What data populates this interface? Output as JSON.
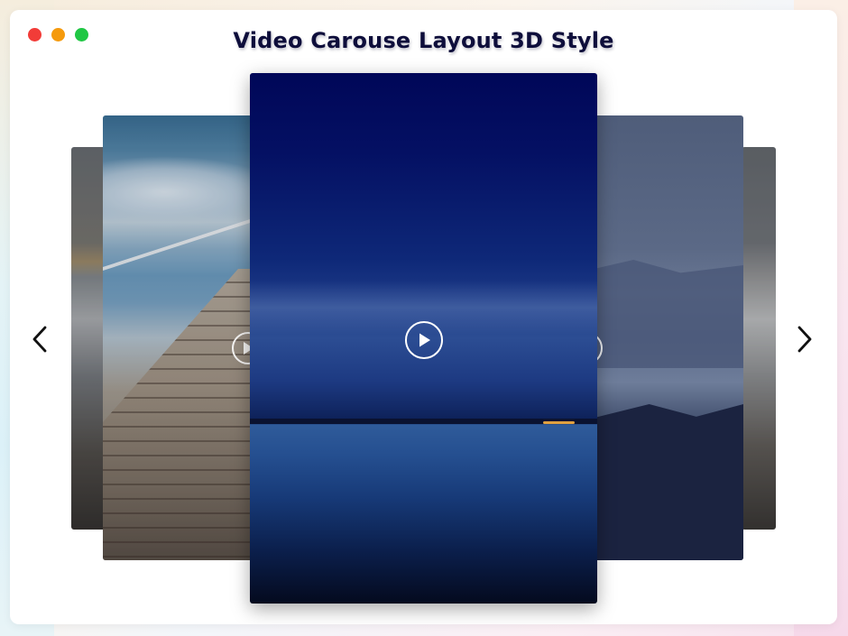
{
  "window": {
    "title": "Video Carouse Layout 3D Style",
    "controls": [
      "close",
      "minimize",
      "maximize"
    ]
  },
  "carousel": {
    "slides": [
      {
        "position": "far-left",
        "scene": "sea-of-clouds",
        "icon": "play-icon"
      },
      {
        "position": "left",
        "scene": "wooden-pier",
        "icon": "play-icon"
      },
      {
        "position": "center",
        "scene": "blue-lake-horizon",
        "icon": "play-icon",
        "active": true
      },
      {
        "position": "right",
        "scene": "misty-mountains",
        "icon": "play-icon"
      },
      {
        "position": "far-right",
        "scene": "sea-of-clouds",
        "icon": "play-icon"
      }
    ],
    "prev_icon": "chevron-left-icon",
    "next_icon": "chevron-right-icon"
  },
  "colors": {
    "close": "#f23c38",
    "minimize": "#f59a0d",
    "maximize": "#20c744",
    "title": "#0e0e3b"
  }
}
